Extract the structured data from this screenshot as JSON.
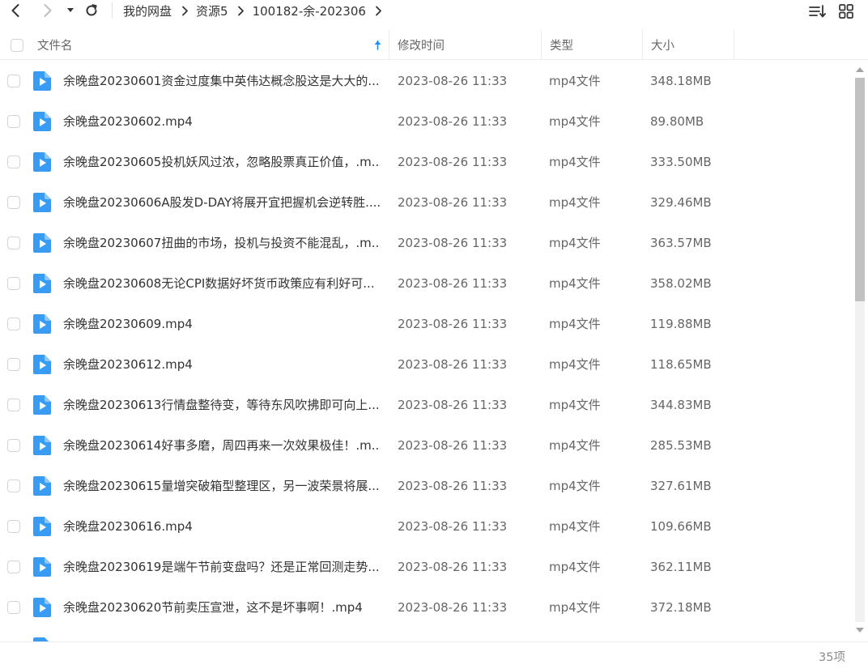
{
  "toolbar": {
    "back_icon": "chevron-left-icon",
    "forward_icon": "chevron-right-icon",
    "history_icon": "caret-down-icon",
    "refresh_icon": "refresh-icon",
    "sort_icon": "sort-list-icon",
    "view_icon": "grid-view-icon"
  },
  "breadcrumb": [
    "我的网盘",
    "资源5",
    "100182-余-202306"
  ],
  "header": {
    "name": "文件名",
    "modified": "修改时间",
    "type": "类型",
    "size": "大小",
    "sort_icon": "arrow-up-icon"
  },
  "files": [
    {
      "name": "余晚盘20230601资金过度集中英伟达概念股这是大大的...",
      "modified": "2023-08-26 11:33",
      "type": "mp4文件",
      "size": "348.18MB"
    },
    {
      "name": "余晚盘20230602.mp4",
      "modified": "2023-08-26 11:33",
      "type": "mp4文件",
      "size": "89.80MB"
    },
    {
      "name": "余晚盘20230605投机妖风过浓，忽略股票真正价值，.m...",
      "modified": "2023-08-26 11:33",
      "type": "mp4文件",
      "size": "333.50MB"
    },
    {
      "name": "余晚盘20230606A股发D-DAY将展开宜把握机会逆转胜....",
      "modified": "2023-08-26 11:33",
      "type": "mp4文件",
      "size": "329.46MB"
    },
    {
      "name": "余晚盘20230607扭曲的市场，投机与投资不能混乱，.m...",
      "modified": "2023-08-26 11:33",
      "type": "mp4文件",
      "size": "363.57MB"
    },
    {
      "name": "余晚盘20230608无论CPI数据好坏货币政策应有利好可...",
      "modified": "2023-08-26 11:33",
      "type": "mp4文件",
      "size": "358.02MB"
    },
    {
      "name": "余晚盘20230609.mp4",
      "modified": "2023-08-26 11:33",
      "type": "mp4文件",
      "size": "119.88MB"
    },
    {
      "name": "余晚盘20230612.mp4",
      "modified": "2023-08-26 11:33",
      "type": "mp4文件",
      "size": "118.65MB"
    },
    {
      "name": "余晚盘20230613行情盘整待变，等待东风吹拂即可向上...",
      "modified": "2023-08-26 11:33",
      "type": "mp4文件",
      "size": "344.83MB"
    },
    {
      "name": "余晚盘20230614好事多磨，周四再来一次效果极佳！.m...",
      "modified": "2023-08-26 11:33",
      "type": "mp4文件",
      "size": "285.53MB"
    },
    {
      "name": "余晚盘20230615量增突破箱型整理区，另一波荣景将展...",
      "modified": "2023-08-26 11:33",
      "type": "mp4文件",
      "size": "327.61MB"
    },
    {
      "name": "余晚盘20230616.mp4",
      "modified": "2023-08-26 11:33",
      "type": "mp4文件",
      "size": "109.66MB"
    },
    {
      "name": "余晚盘20230619是端午节前变盘吗？还是正常回测走势...",
      "modified": "2023-08-26 11:33",
      "type": "mp4文件",
      "size": "362.11MB"
    },
    {
      "name": "余晚盘20230620节前卖压宣泄，这不是坏事啊！.mp4",
      "modified": "2023-08-26 11:33",
      "type": "mp4文件",
      "size": "372.18MB"
    }
  ],
  "file_icon": "video-file-icon",
  "footer": {
    "count": "35项"
  },
  "colors": {
    "file_icon": "#3a9bf2",
    "sort_arrow": "#1f8cf2",
    "border": "#ececec",
    "scroll_thumb": "#c1c1c1"
  }
}
